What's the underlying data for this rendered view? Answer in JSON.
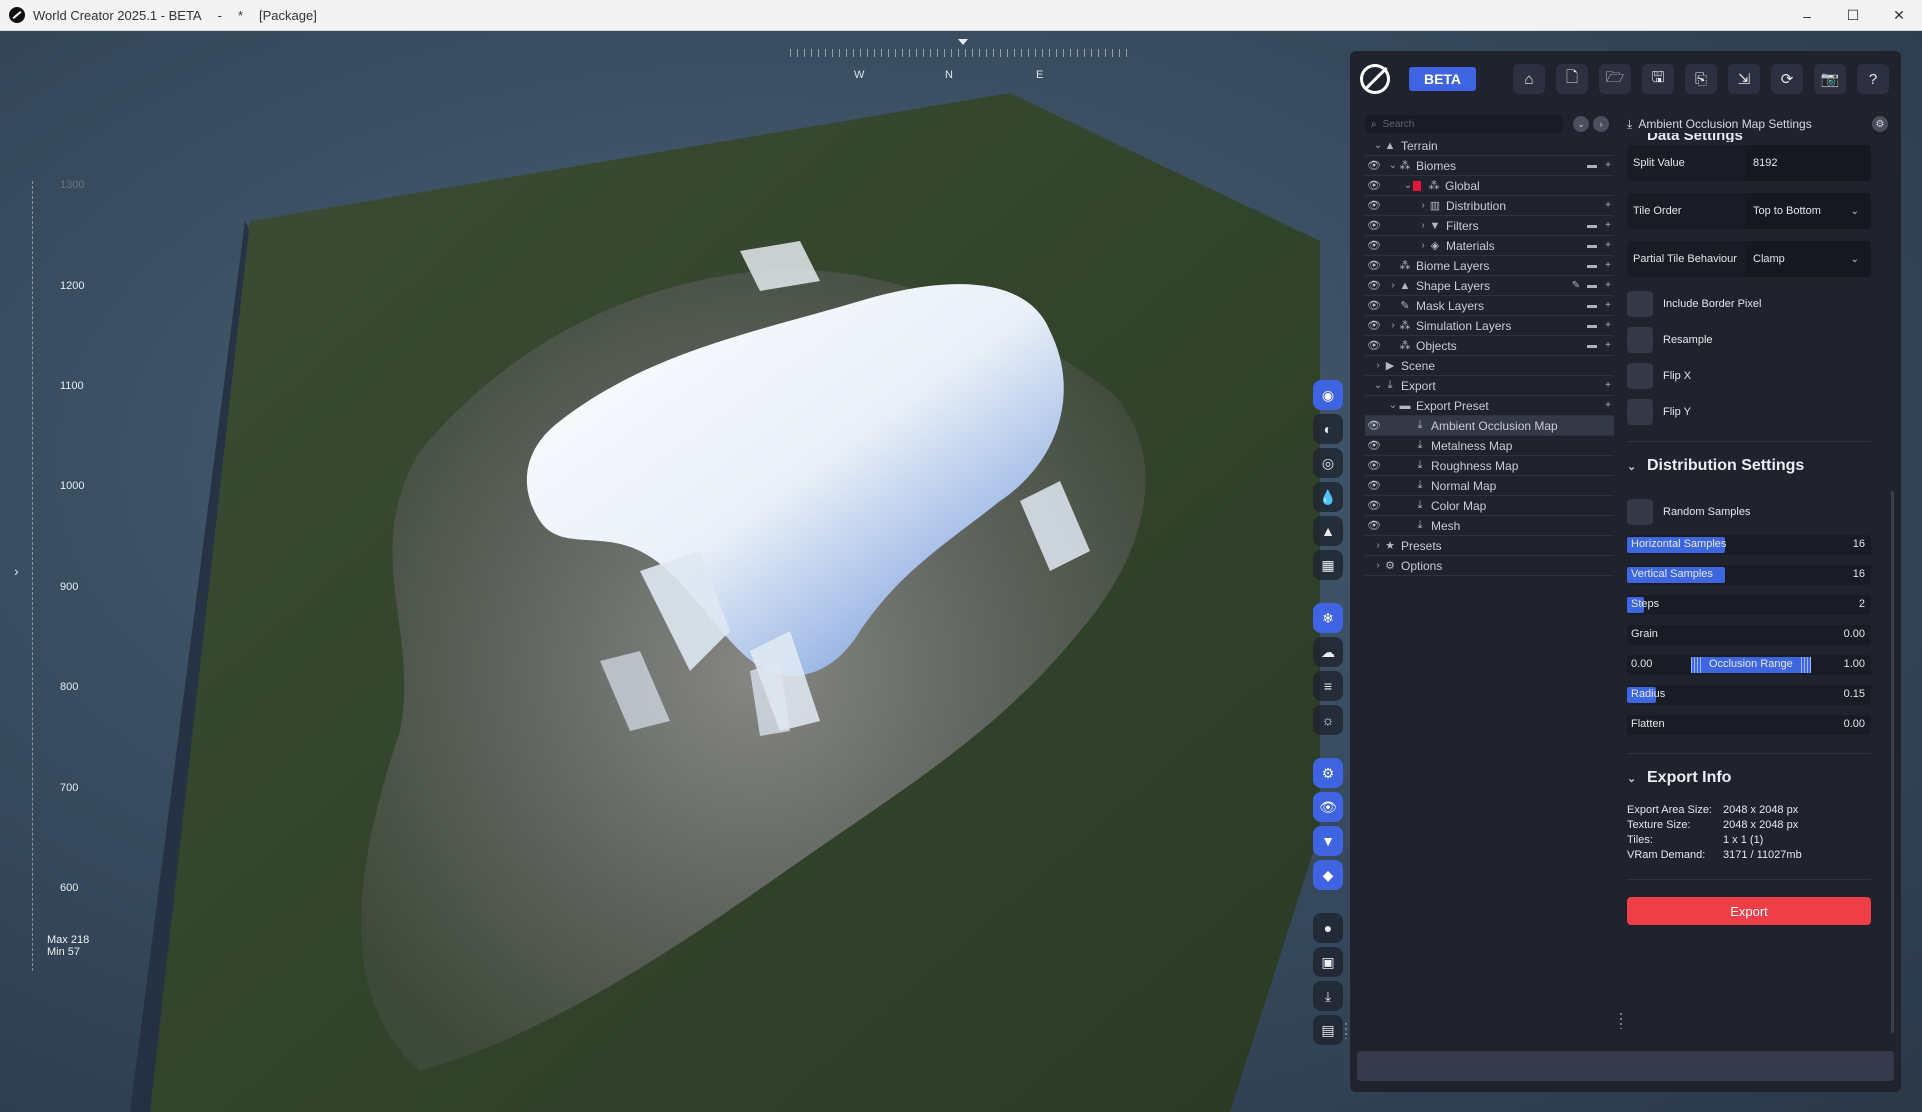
{
  "window": {
    "app_title": "World Creator 2025.1 - BETA",
    "separator": "-",
    "modified": "*",
    "document": "[Package]",
    "controls": [
      "–",
      "☐",
      "✕"
    ]
  },
  "viewport": {
    "compass": {
      "w": "W",
      "n": "N",
      "e": "E"
    },
    "elevation_labels": [
      "1300",
      "1200",
      "1100",
      "1000",
      "900",
      "800",
      "700",
      "600"
    ],
    "max_label": "Max 218",
    "min_label": "Min 57",
    "expand_chevron": "›"
  },
  "toolbar_icons": [
    {
      "name": "terrain-mode-icon",
      "glyph": "◉",
      "accent": true
    },
    {
      "name": "sphere-icon",
      "glyph": "◐",
      "accent": false
    },
    {
      "name": "globe-icon",
      "glyph": "◎",
      "accent": false
    },
    {
      "name": "water-drop-icon",
      "glyph": "💧",
      "accent": false
    },
    {
      "name": "mountain-icon",
      "glyph": "▲",
      "accent": false
    },
    {
      "name": "grid-icon",
      "glyph": "▦",
      "accent": false
    },
    {
      "name": "snowflake-icon",
      "glyph": "❄",
      "accent": true
    },
    {
      "name": "cloud-icon",
      "glyph": "☁",
      "accent": false
    },
    {
      "name": "fog-icon",
      "glyph": "≡",
      "accent": false
    },
    {
      "name": "sun-lamp-icon",
      "glyph": "☼",
      "accent": false
    },
    {
      "name": "brush-settings-icon",
      "glyph": "⚙",
      "accent": true
    },
    {
      "name": "visibility-icon",
      "glyph": "👁",
      "accent": true
    },
    {
      "name": "filter-icon",
      "glyph": "▼",
      "accent": true
    },
    {
      "name": "layers-icon",
      "glyph": "◆",
      "accent": true
    },
    {
      "name": "record-icon",
      "glyph": "●",
      "accent": false
    },
    {
      "name": "image-icon",
      "glyph": "▣",
      "accent": false
    },
    {
      "name": "download-icon",
      "glyph": "⤓",
      "accent": false
    },
    {
      "name": "stats-icon",
      "glyph": "▤",
      "accent": false
    }
  ],
  "panel": {
    "beta_label": "BETA",
    "header_icons": [
      {
        "name": "home-icon",
        "glyph": "⌂"
      },
      {
        "name": "new-file-icon",
        "glyph": "🗋"
      },
      {
        "name": "open-folder-icon",
        "glyph": "🗁"
      },
      {
        "name": "save-icon",
        "glyph": "🖫"
      },
      {
        "name": "save-as-icon",
        "glyph": "⎘"
      },
      {
        "name": "export-file-icon",
        "glyph": "⇲"
      },
      {
        "name": "sync-icon",
        "glyph": "⟳"
      },
      {
        "name": "camera-icon",
        "glyph": "📷"
      },
      {
        "name": "support-icon",
        "glyph": "?"
      }
    ],
    "search_placeholder": "Search",
    "tree": [
      {
        "depth": 0,
        "eye": false,
        "chev": "⌄",
        "icon": "▲",
        "label": "Terrain",
        "actions": []
      },
      {
        "depth": 1,
        "eye": true,
        "chev": "⌄",
        "icon": "⁂",
        "label": "Biomes",
        "actions": [
          "▬",
          "+"
        ]
      },
      {
        "depth": 2,
        "eye": true,
        "chev": "⌄",
        "icon": "⁂",
        "color": true,
        "label": "Global",
        "actions": []
      },
      {
        "depth": 3,
        "eye": true,
        "chev": "›",
        "icon": "▥",
        "label": "Distribution",
        "actions": [
          "+"
        ]
      },
      {
        "depth": 3,
        "eye": true,
        "chev": "›",
        "icon": "▼",
        "label": "Filters",
        "actions": [
          "▬",
          "+"
        ]
      },
      {
        "depth": 3,
        "eye": true,
        "chev": "›",
        "icon": "◈",
        "label": "Materials",
        "actions": [
          "▬",
          "+"
        ]
      },
      {
        "depth": 1,
        "eye": true,
        "chev": "",
        "icon": "⁂",
        "label": "Biome Layers",
        "actions": [
          "▬",
          "+"
        ]
      },
      {
        "depth": 1,
        "eye": true,
        "chev": "›",
        "icon": "▲",
        "label": "Shape Layers",
        "actions": [
          "✎",
          "▬",
          "+"
        ]
      },
      {
        "depth": 1,
        "eye": true,
        "chev": "",
        "icon": "✎",
        "label": "Mask Layers",
        "actions": [
          "▬",
          "+"
        ]
      },
      {
        "depth": 1,
        "eye": true,
        "chev": "›",
        "icon": "⁂",
        "label": "Simulation Layers",
        "actions": [
          "▬",
          "+"
        ]
      },
      {
        "depth": 1,
        "eye": true,
        "chev": "",
        "icon": "⁂",
        "label": "Objects",
        "actions": [
          "▬",
          "+"
        ]
      },
      {
        "depth": 0,
        "eye": false,
        "chev": "›",
        "icon": "▶",
        "label": "Scene",
        "actions": []
      },
      {
        "depth": 0,
        "eye": false,
        "chev": "⌄",
        "icon": "⤓",
        "label": "Export",
        "actions": [
          "+"
        ]
      },
      {
        "depth": 1,
        "eye": false,
        "chev": "⌄",
        "icon": "▬",
        "label": "Export Preset",
        "actions": [
          "+"
        ]
      },
      {
        "depth": 2,
        "eye": true,
        "chev": "",
        "icon": "⤓",
        "label": "Ambient Occlusion Map",
        "selected": true,
        "actions": []
      },
      {
        "depth": 2,
        "eye": true,
        "chev": "",
        "icon": "⤓",
        "label": "Metalness Map",
        "actions": []
      },
      {
        "depth": 2,
        "eye": true,
        "chev": "",
        "icon": "⤓",
        "label": "Roughness Map",
        "actions": []
      },
      {
        "depth": 2,
        "eye": true,
        "chev": "",
        "icon": "⤓",
        "label": "Normal Map",
        "actions": []
      },
      {
        "depth": 2,
        "eye": true,
        "chev": "",
        "icon": "⤓",
        "label": "Color Map",
        "actions": []
      },
      {
        "depth": 2,
        "eye": true,
        "chev": "",
        "icon": "⤓",
        "label": "Mesh",
        "actions": []
      },
      {
        "depth": 0,
        "eye": false,
        "chev": "›",
        "icon": "★",
        "label": "Presets",
        "actions": []
      },
      {
        "depth": 0,
        "eye": false,
        "chev": "›",
        "icon": "⚙",
        "label": "Options",
        "actions": []
      }
    ],
    "settings": {
      "title": "Ambient Occlusion Map Settings",
      "data_settings_heading": "Data Settings",
      "split_value": {
        "label": "Split Value",
        "value": "8192"
      },
      "tile_order": {
        "label": "Tile Order",
        "value": "Top to Bottom"
      },
      "partial_tile": {
        "label": "Partial Tile Behaviour",
        "value": "Clamp"
      },
      "checkboxes": [
        "Include Border Pixel",
        "Resample",
        "Flip X",
        "Flip Y"
      ],
      "distribution_heading": "Distribution Settings",
      "random_samples": "Random Samples",
      "sliders": [
        {
          "label": "Horizontal Samples",
          "value": "16",
          "fraction": 0.4
        },
        {
          "label": "Vertical Samples",
          "value": "16",
          "fraction": 0.4
        },
        {
          "label": "Steps",
          "value": "2",
          "fraction": 0.07
        },
        {
          "label": "Grain",
          "value": "0.00",
          "fraction": 0
        },
        {
          "label": "Radius",
          "value": "0.15",
          "fraction": 0.12
        },
        {
          "label": "Flatten",
          "value": "0.00",
          "fraction": 0
        }
      ],
      "occlusion_range": {
        "label": "Occlusion Range",
        "min": "0.00",
        "max": "1.00"
      },
      "export_info_heading": "Export Info",
      "export_info": [
        {
          "key": "Export Area Size:",
          "value": "2048 x 2048 px"
        },
        {
          "key": "Texture Size:",
          "value": "2048 x 2048 px"
        },
        {
          "key": "Tiles:",
          "value": "1 x 1   (1)"
        },
        {
          "key": "VRam Demand:",
          "value": "3171 / 11027mb"
        }
      ],
      "export_button": "Export"
    }
  },
  "colors": {
    "accent": "#3f64e2",
    "export": "#ef3e47",
    "biome_color": "#e4163a"
  }
}
